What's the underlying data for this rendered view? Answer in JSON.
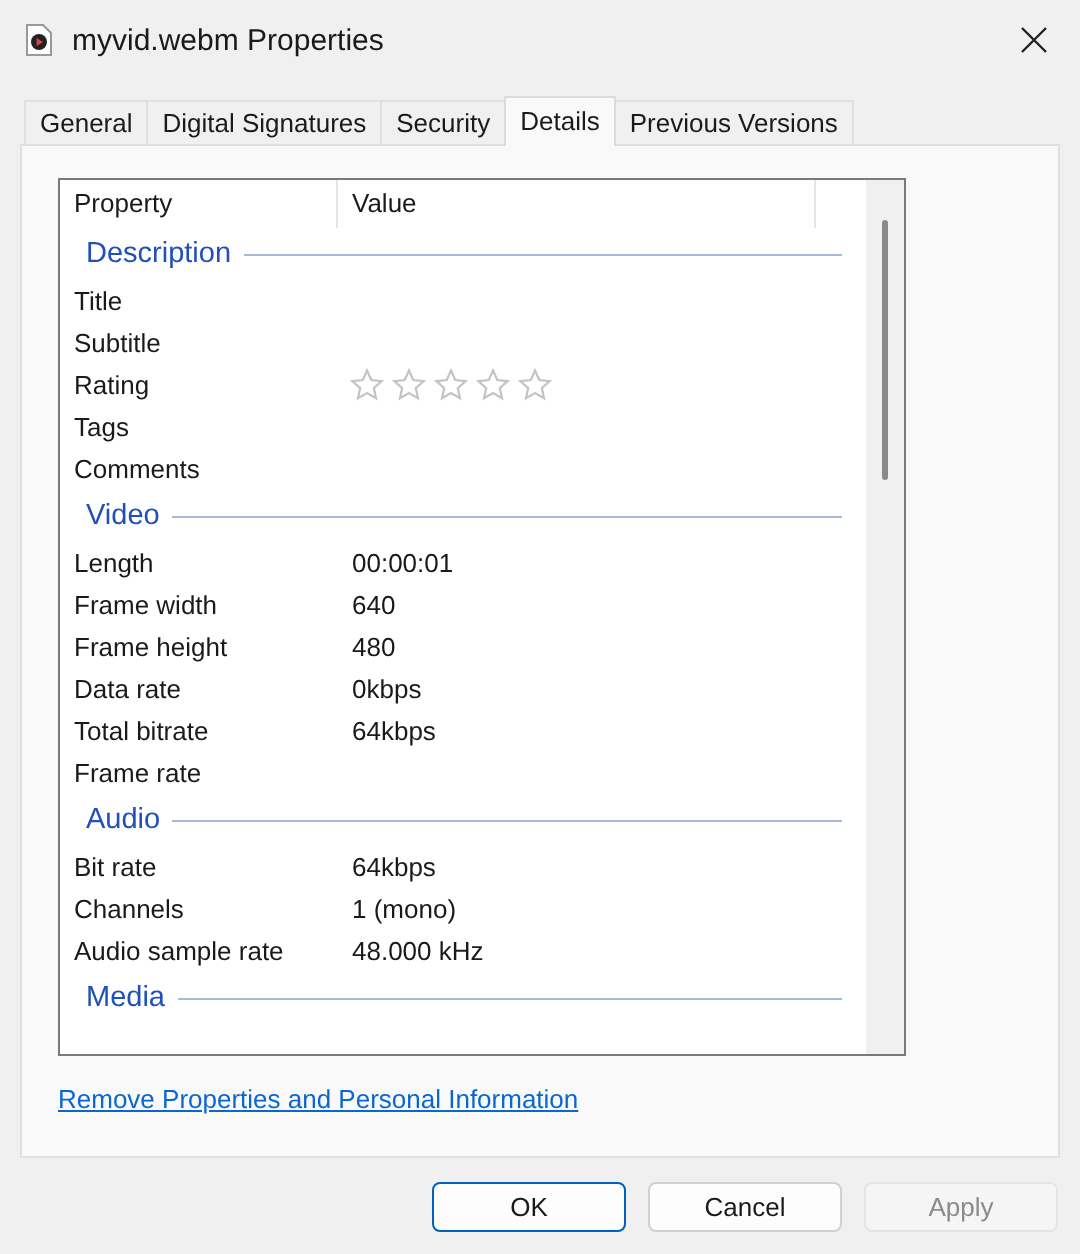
{
  "window": {
    "title": "myvid.webm Properties"
  },
  "tabs": [
    {
      "label": "General",
      "selected": false
    },
    {
      "label": "Digital Signatures",
      "selected": false
    },
    {
      "label": "Security",
      "selected": false
    },
    {
      "label": "Details",
      "selected": true
    },
    {
      "label": "Previous Versions",
      "selected": false
    }
  ],
  "table": {
    "columns": [
      "Property",
      "Value"
    ],
    "sections": [
      {
        "title": "Description",
        "rows": [
          {
            "kind": "text",
            "property": "Title"
          },
          {
            "kind": "text",
            "property": "Subtitle"
          },
          {
            "kind": "rating",
            "property": "Rating",
            "stars": 0
          },
          {
            "kind": "text",
            "property": "Tags"
          },
          {
            "kind": "text",
            "property": "Comments"
          }
        ]
      },
      {
        "title": "Video",
        "rows": [
          {
            "kind": "text",
            "property": "Length",
            "value": "00:00:01"
          },
          {
            "kind": "text",
            "property": "Frame width",
            "value": "640"
          },
          {
            "kind": "text",
            "property": "Frame height",
            "value": "480"
          },
          {
            "kind": "text",
            "property": "Data rate",
            "value": "0kbps"
          },
          {
            "kind": "text",
            "property": "Total bitrate",
            "value": "64kbps"
          },
          {
            "kind": "text",
            "property": "Frame rate"
          }
        ]
      },
      {
        "title": "Audio",
        "rows": [
          {
            "kind": "text",
            "property": "Bit rate",
            "value": "64kbps"
          },
          {
            "kind": "text",
            "property": "Channels",
            "value": "1 (mono)"
          },
          {
            "kind": "text",
            "property": "Audio sample rate",
            "value": "48.000 kHz"
          }
        ]
      },
      {
        "title": "Media"
      }
    ]
  },
  "link": "Remove Properties and Personal Information",
  "buttons": [
    {
      "label": "OK",
      "default": true,
      "disabled": false
    },
    {
      "label": "Cancel",
      "default": false,
      "disabled": false
    },
    {
      "label": "Apply",
      "default": false,
      "disabled": true
    }
  ]
}
